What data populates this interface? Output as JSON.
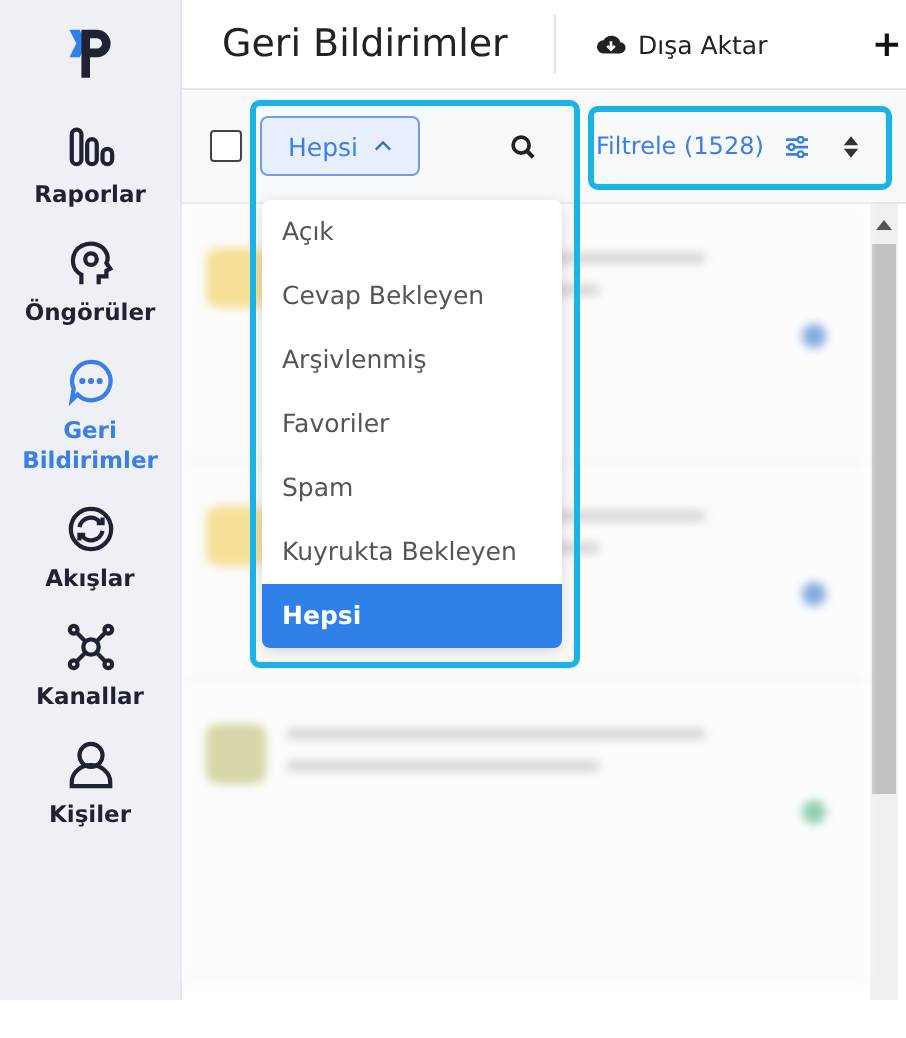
{
  "sidebar": {
    "items": [
      {
        "kind": "chart",
        "label": "Raporlar",
        "selected": false
      },
      {
        "kind": "head",
        "label": "Öngörüler",
        "selected": false
      },
      {
        "kind": "chat",
        "label": "Geri Bildirimler",
        "selected": true
      },
      {
        "kind": "sync",
        "label": "Akışlar",
        "selected": false
      },
      {
        "kind": "network",
        "label": "Kanallar",
        "selected": false
      },
      {
        "kind": "person",
        "label": "Kişiler",
        "selected": false
      }
    ]
  },
  "header": {
    "title": "Geri Bildirimler",
    "export_label": "Dışa Aktar",
    "add_label": "+"
  },
  "toolbar": {
    "select_all_checked": false,
    "status_filter": "Hepsi",
    "status_menu_expanded": true,
    "filter_label": "Filtrele (1528)"
  },
  "status_menu": {
    "items": [
      {
        "label": "Açık",
        "selected": false
      },
      {
        "label": "Cevap Bekleyen",
        "selected": false
      },
      {
        "label": "Arşivlenmiş",
        "selected": false
      },
      {
        "label": "Favoriler",
        "selected": false
      },
      {
        "label": "Spam",
        "selected": false
      },
      {
        "label": "Kuyrukta Bekleyen",
        "selected": false
      },
      {
        "label": "Hepsi",
        "selected": true
      }
    ]
  }
}
